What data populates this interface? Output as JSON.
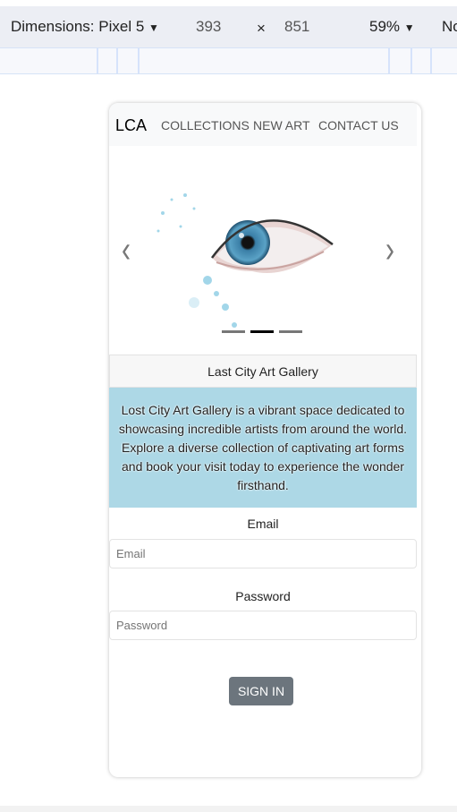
{
  "devtools": {
    "dimensions_label": "Dimensions: Pixel 5",
    "width": "393",
    "times": "×",
    "height": "851",
    "zoom": "59%",
    "more": "No"
  },
  "nav": {
    "brand": "LCA",
    "links": [
      "COLLECTIONS",
      "NEW ART",
      "CONTACT US"
    ]
  },
  "carousel": {
    "prev": "‹",
    "next": "›",
    "active_index": 1,
    "count": 3
  },
  "card": {
    "title": "Last City Art Gallery",
    "description": "Lost City Art Gallery is a vibrant space dedicated to showcasing incredible artists from around the world. Explore a diverse collection of captivating art forms and book your visit today to experience the wonder firsthand."
  },
  "form": {
    "email_label": "Email",
    "email_placeholder": "Email",
    "password_label": "Password",
    "password_placeholder": "Password",
    "submit": "SIGN IN"
  }
}
